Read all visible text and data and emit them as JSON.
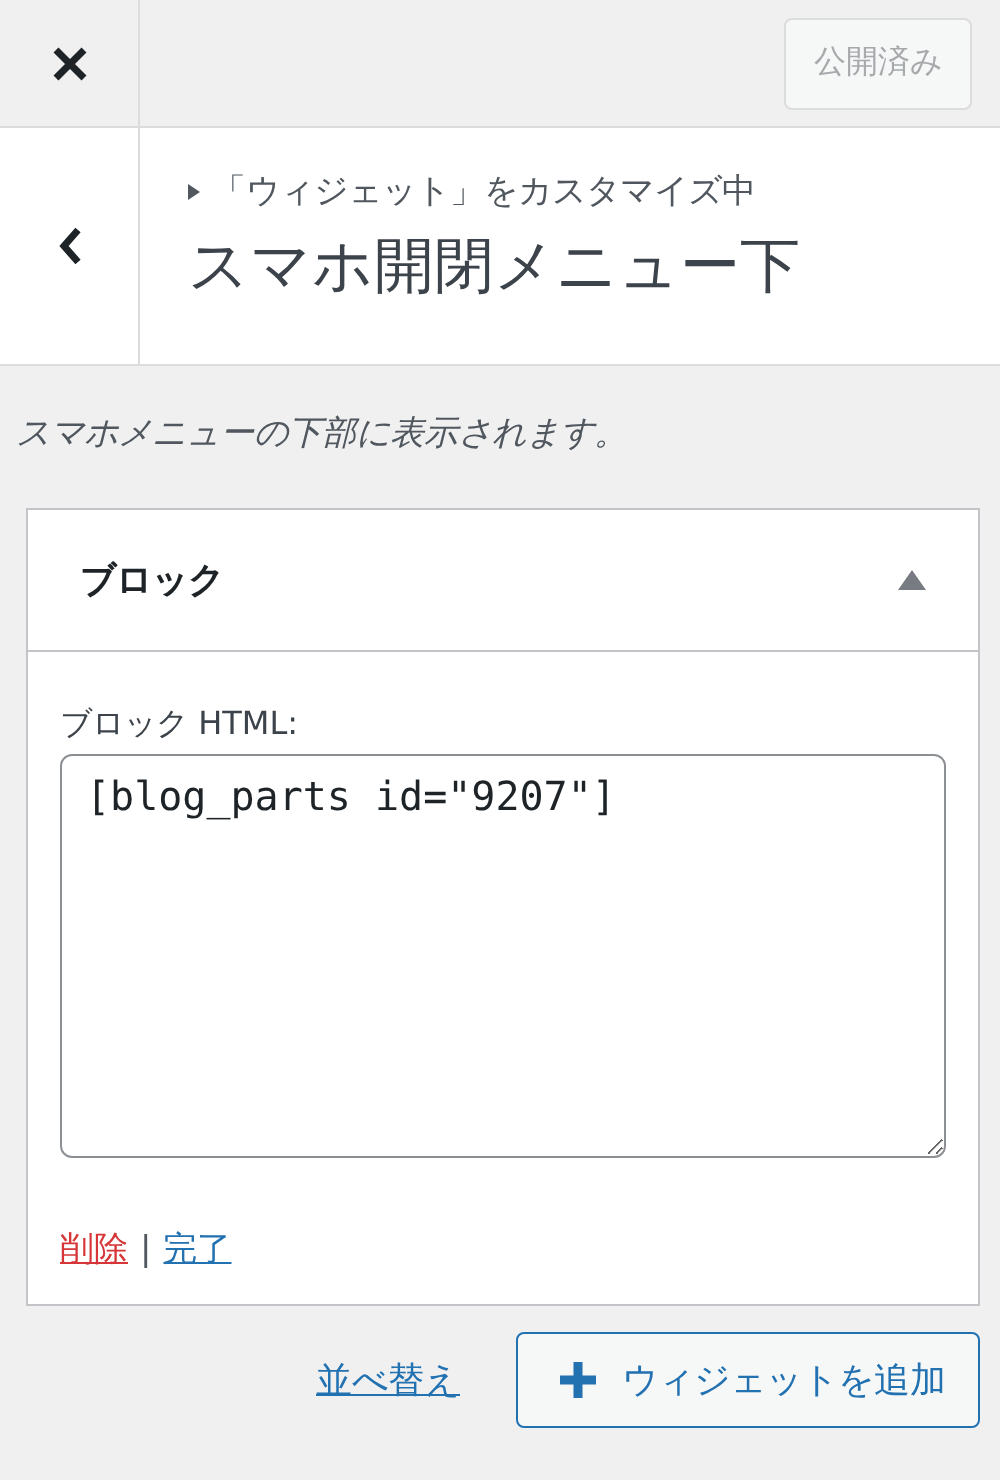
{
  "header": {
    "publish_button": {
      "label": "公開済み",
      "disabled": true
    }
  },
  "section": {
    "breadcrumb": "「ウィジェット」をカスタマイズ中",
    "title": "スマホ開閉メニュー下"
  },
  "description": "スマホメニューの下部に表示されます。",
  "widget": {
    "title": "ブロック",
    "expanded": true,
    "field_label": "ブロック HTML:",
    "value": "[blog_parts id=\"9207\"]",
    "delete_link": "削除",
    "separator": "|",
    "done_link": "完了"
  },
  "footer": {
    "reorder_link": "並べ替え",
    "add_button": "ウィジェットを追加"
  }
}
